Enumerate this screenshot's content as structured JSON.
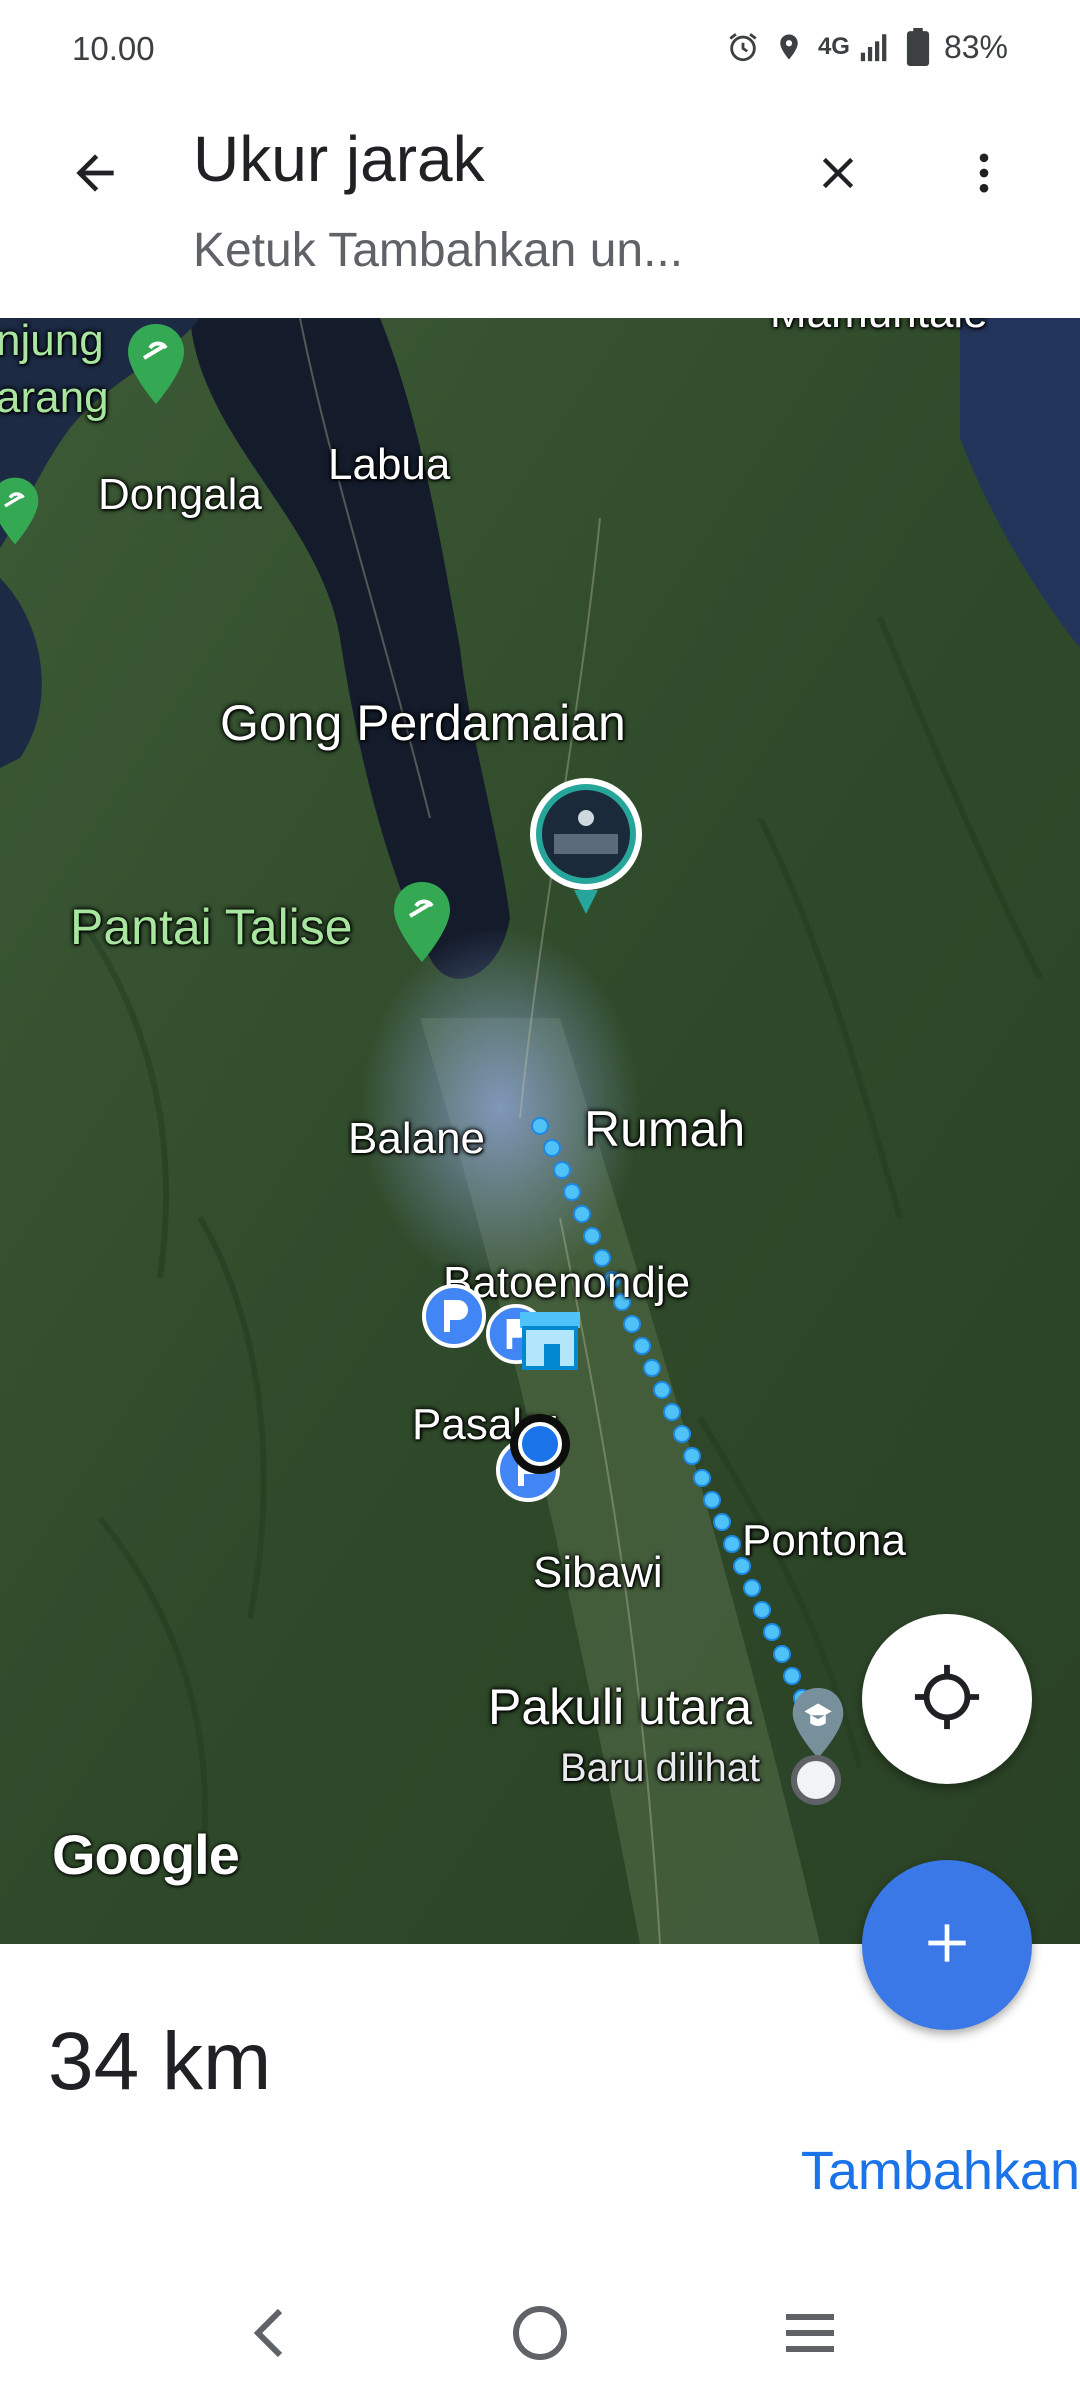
{
  "status_bar": {
    "time": "10.00",
    "network": "4G",
    "battery": "83%",
    "icons": [
      "alarm-icon",
      "location-icon",
      "signal-icon",
      "battery-icon"
    ]
  },
  "app_bar": {
    "title": "Ukur jarak",
    "subtitle": "Ketuk Tambahkan un...",
    "back_icon": "arrow-back-icon",
    "close_icon": "close-icon",
    "more_icon": "more-vert-icon"
  },
  "map": {
    "labels": {
      "tanjung_karang_1": "njung",
      "tanjung_karang_2": "arang",
      "mamuntale": "Mamuntale",
      "labua": "Labua",
      "dongala": "Dongala",
      "gong_perdamaian": "Gong Perdamaian",
      "pantai_talise": "Pantai Talise",
      "balane": "Balane",
      "rumah": "Rumah",
      "batoenondje": "Batoenondje",
      "pasaku": "Pasaku",
      "pontona": "Pontona",
      "sibawi": "Sibawi",
      "pakuli_utara": "Pakuli utara",
      "baru_dilihat": "Baru dilihat"
    },
    "logo": "Google",
    "route_color": "#4fc3f7",
    "accent_blue": "#1a73e8"
  },
  "measurement": {
    "distance": "34 km",
    "add_label": "Tambahkan"
  },
  "nav_bar": {
    "back_icon": "nav-back-icon",
    "home_icon": "nav-home-icon",
    "recents_icon": "nav-recents-icon"
  }
}
